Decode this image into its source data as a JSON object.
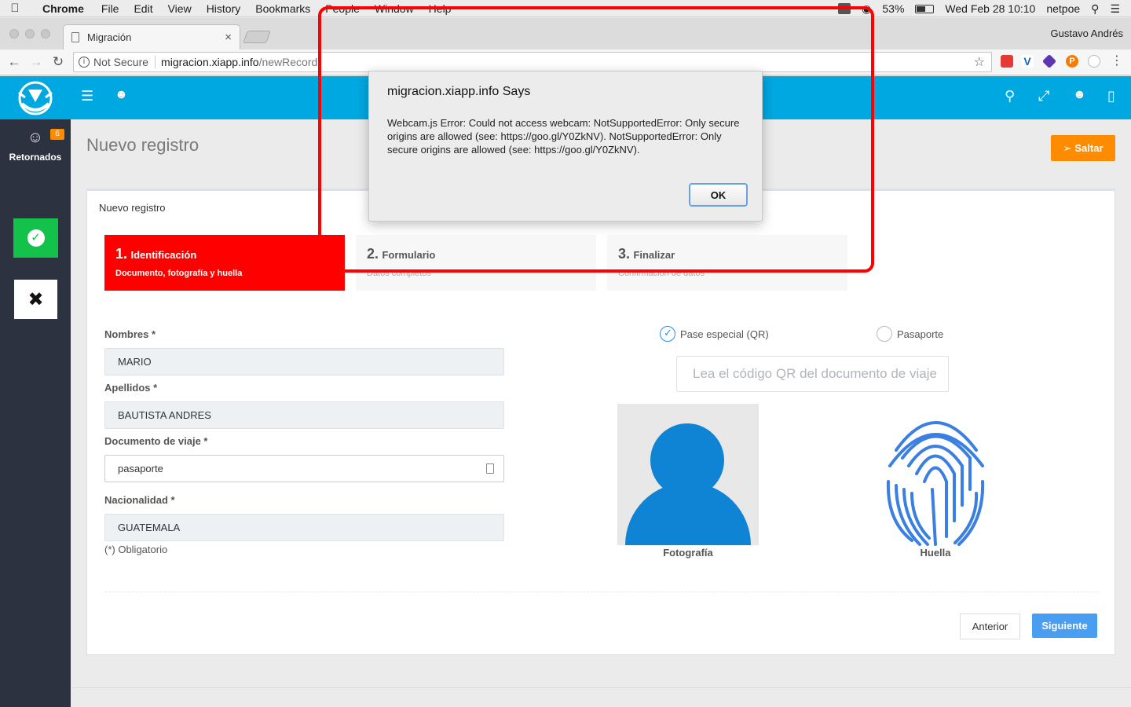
{
  "menubar": {
    "app_name": "Chrome",
    "items": [
      "File",
      "Edit",
      "View",
      "History",
      "Bookmarks",
      "People",
      "Window",
      "Help"
    ],
    "battery": "53%",
    "datetime": "Wed Feb 28  10:10",
    "user": "netpoe"
  },
  "browser": {
    "tab_title": "Migración",
    "profile_name": "Gustavo Andrés",
    "security_label": "Not Secure",
    "url_host": "migracion.xiapp.info",
    "url_path": "/newRecord"
  },
  "sidebar": {
    "retornados_label": "Retornados",
    "retornados_count": "6"
  },
  "page": {
    "title": "Nuevo registro",
    "saltar_label": "Saltar",
    "card_title": "Nuevo registro"
  },
  "steps": [
    {
      "num": "1.",
      "label": "Identificación",
      "sub": "Documento, fotografía y huella"
    },
    {
      "num": "2.",
      "label": "Formulario",
      "sub": "Datos completos"
    },
    {
      "num": "3.",
      "label": "Finalizar",
      "sub": "Confirmación de datos"
    }
  ],
  "form": {
    "nombres_label": "Nombres *",
    "nombres_value": "MARIO",
    "apellidos_label": "Apellidos *",
    "apellidos_value": "BAUTISTA ANDRES",
    "documento_label": "Documento de viaje *",
    "documento_value": "pasaporte",
    "nacionalidad_label": "Nacionalidad *",
    "nacionalidad_value": "GUATEMALA",
    "obligatorio": "(*) Obligatorio"
  },
  "scan": {
    "radio_qr": "Pase especial (QR)",
    "radio_pasaporte": "Pasaporte",
    "qr_placeholder": "Lea el código QR del documento de viaje",
    "photo_caption": "Fotografía",
    "fingerprint_caption": "Huella"
  },
  "actions": {
    "prev_label": "Anterior",
    "next_label": "Siguiente"
  },
  "dialog": {
    "title": "migracion.xiapp.info Says",
    "message": "Webcam.js Error: Could not access webcam: NotSupportedError: Only secure origins are allowed (see: https://goo.gl/Y0ZkNV). NotSupportedError: Only secure origins are allowed (see: https://goo.gl/Y0ZkNV).",
    "ok_label": "OK"
  },
  "colors": {
    "app_header": "#00a8e1",
    "sidebar": "#2c3240",
    "active_step": "#ff0000",
    "saltar": "#ff8c00",
    "primary": "#4a9ef2",
    "success": "#14c14a",
    "highlight": "#ff0000"
  }
}
